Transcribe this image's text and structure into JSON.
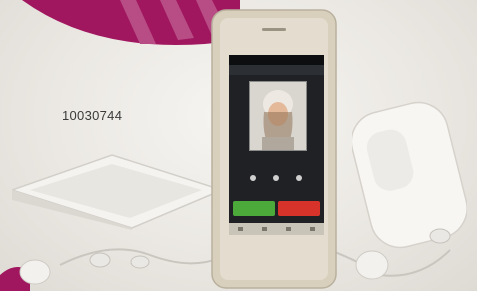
{
  "product_code": "10030744",
  "colors": {
    "banner": "#a0175f",
    "answer": "#4caa3a",
    "decline": "#d8332a",
    "phone_body": "#d8cfbd"
  },
  "screen": {
    "icons": [
      "mute-icon",
      "keypad-icon",
      "speaker-icon"
    ]
  }
}
